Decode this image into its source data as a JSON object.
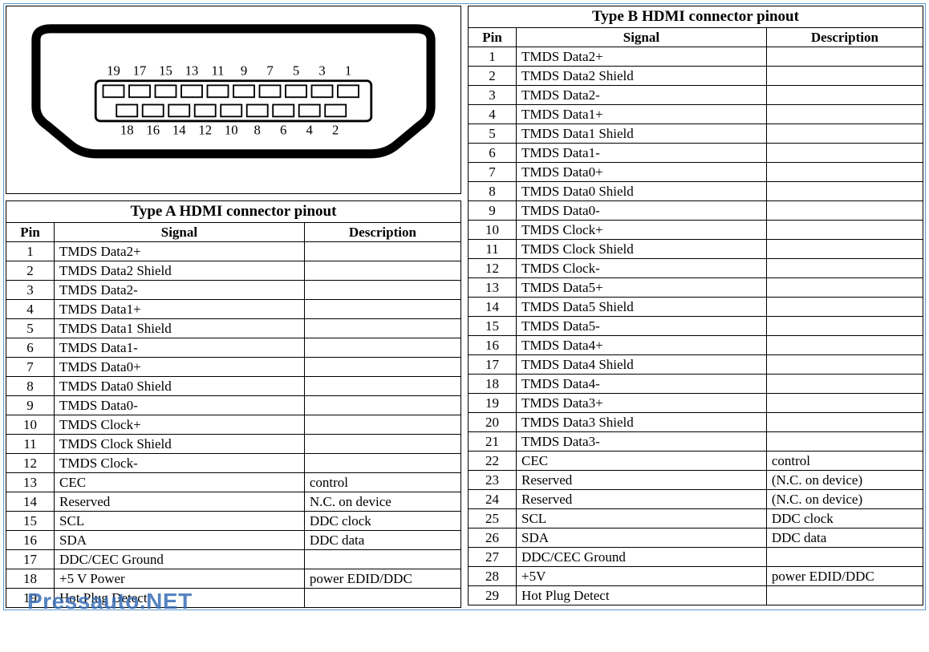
{
  "watermark": "Pressauto.NET",
  "connector": {
    "top_labels": [
      "19",
      "17",
      "15",
      "13",
      "11",
      "9",
      "7",
      "5",
      "3",
      "1"
    ],
    "bottom_labels": [
      "18",
      "16",
      "14",
      "12",
      "10",
      "8",
      "6",
      "4",
      "2"
    ]
  },
  "tableA": {
    "title": "Type A HDMI connector pinout",
    "headers": {
      "pin": "Pin",
      "signal": "Signal",
      "description": "Description"
    },
    "rows": [
      {
        "pin": "1",
        "signal": "TMDS Data2+",
        "desc": ""
      },
      {
        "pin": "2",
        "signal": "TMDS Data2 Shield",
        "desc": ""
      },
      {
        "pin": "3",
        "signal": "TMDS Data2-",
        "desc": ""
      },
      {
        "pin": "4",
        "signal": "TMDS Data1+",
        "desc": ""
      },
      {
        "pin": "5",
        "signal": "TMDS Data1 Shield",
        "desc": ""
      },
      {
        "pin": "6",
        "signal": "TMDS Data1-",
        "desc": ""
      },
      {
        "pin": "7",
        "signal": "TMDS Data0+",
        "desc": ""
      },
      {
        "pin": "8",
        "signal": "TMDS Data0 Shield",
        "desc": ""
      },
      {
        "pin": "9",
        "signal": "TMDS Data0-",
        "desc": ""
      },
      {
        "pin": "10",
        "signal": "TMDS Clock+",
        "desc": ""
      },
      {
        "pin": "11",
        "signal": "TMDS Clock Shield",
        "desc": ""
      },
      {
        "pin": "12",
        "signal": "TMDS Clock-",
        "desc": ""
      },
      {
        "pin": "13",
        "signal": "CEC",
        "desc": "control"
      },
      {
        "pin": "14",
        "signal": "Reserved",
        "desc": "N.C. on device"
      },
      {
        "pin": "15",
        "signal": "SCL",
        "desc": "DDC clock"
      },
      {
        "pin": "16",
        "signal": "SDA",
        "desc": "DDC data"
      },
      {
        "pin": "17",
        "signal": "DDC/CEC Ground",
        "desc": ""
      },
      {
        "pin": "18",
        "signal": "+5 V Power",
        "desc": "power EDID/DDC"
      },
      {
        "pin": "19",
        "signal": "Hot Plug Detect",
        "desc": ""
      }
    ]
  },
  "tableB": {
    "title": "Type B HDMI connector pinout",
    "headers": {
      "pin": "Pin",
      "signal": "Signal",
      "description": "Description"
    },
    "rows": [
      {
        "pin": "1",
        "signal": "TMDS Data2+",
        "desc": ""
      },
      {
        "pin": "2",
        "signal": "TMDS Data2 Shield",
        "desc": ""
      },
      {
        "pin": "3",
        "signal": "TMDS Data2-",
        "desc": ""
      },
      {
        "pin": "4",
        "signal": "TMDS Data1+",
        "desc": ""
      },
      {
        "pin": "5",
        "signal": "TMDS Data1 Shield",
        "desc": ""
      },
      {
        "pin": "6",
        "signal": "TMDS Data1-",
        "desc": ""
      },
      {
        "pin": "7",
        "signal": "TMDS Data0+",
        "desc": ""
      },
      {
        "pin": "8",
        "signal": "TMDS Data0 Shield",
        "desc": ""
      },
      {
        "pin": "9",
        "signal": "TMDS Data0-",
        "desc": ""
      },
      {
        "pin": "10",
        "signal": "TMDS Clock+",
        "desc": ""
      },
      {
        "pin": "11",
        "signal": "TMDS Clock Shield",
        "desc": ""
      },
      {
        "pin": "12",
        "signal": "TMDS Clock-",
        "desc": ""
      },
      {
        "pin": "13",
        "signal": "TMDS Data5+",
        "desc": ""
      },
      {
        "pin": "14",
        "signal": "TMDS Data5 Shield",
        "desc": ""
      },
      {
        "pin": "15",
        "signal": "TMDS Data5-",
        "desc": ""
      },
      {
        "pin": "16",
        "signal": "TMDS Data4+",
        "desc": ""
      },
      {
        "pin": "17",
        "signal": "TMDS Data4 Shield",
        "desc": ""
      },
      {
        "pin": "18",
        "signal": "TMDS Data4-",
        "desc": ""
      },
      {
        "pin": "19",
        "signal": "TMDS Data3+",
        "desc": ""
      },
      {
        "pin": "20",
        "signal": "TMDS Data3 Shield",
        "desc": ""
      },
      {
        "pin": "21",
        "signal": "TMDS Data3-",
        "desc": ""
      },
      {
        "pin": "22",
        "signal": "CEC",
        "desc": "control"
      },
      {
        "pin": "23",
        "signal": "Reserved",
        "desc": "(N.C. on device)"
      },
      {
        "pin": "24",
        "signal": "Reserved",
        "desc": "(N.C. on device)"
      },
      {
        "pin": "25",
        "signal": "SCL",
        "desc": "DDC clock"
      },
      {
        "pin": "26",
        "signal": "SDA",
        "desc": "DDC data"
      },
      {
        "pin": "27",
        "signal": "DDC/CEC Ground",
        "desc": ""
      },
      {
        "pin": "28",
        "signal": "+5V",
        "desc": "power EDID/DDC"
      },
      {
        "pin": "29",
        "signal": "Hot Plug Detect",
        "desc": ""
      }
    ]
  }
}
